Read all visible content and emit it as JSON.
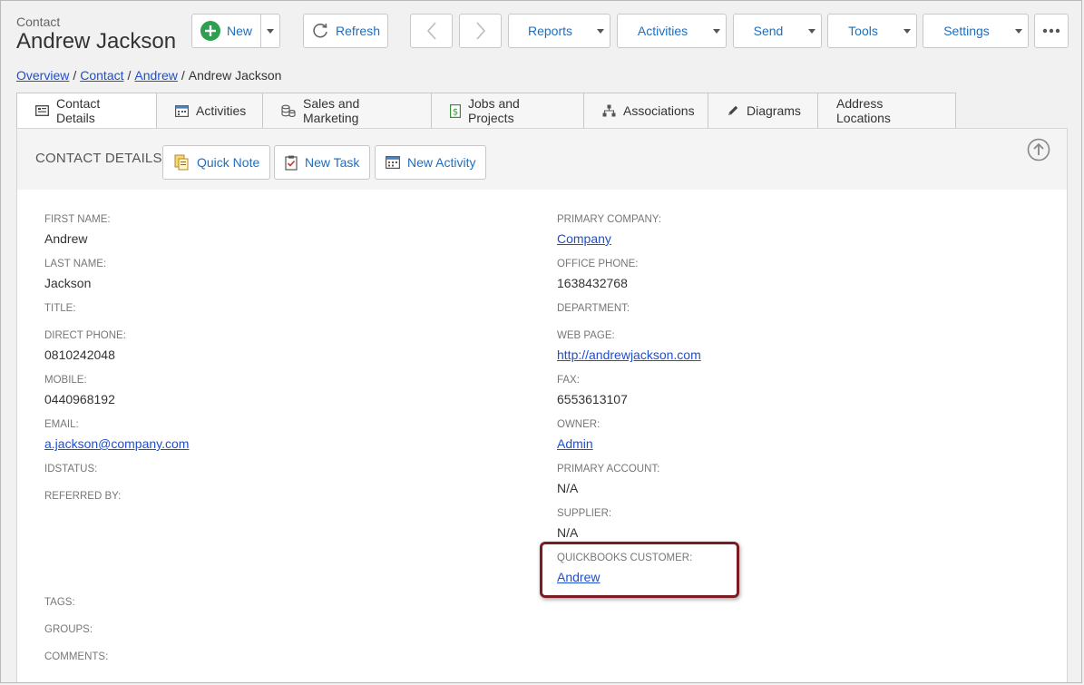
{
  "header": {
    "entity_type": "Contact",
    "entity_name": "Andrew Jackson"
  },
  "toolbar": {
    "new_label": "New",
    "refresh_label": "Refresh",
    "reports_label": "Reports",
    "activities_label": "Activities",
    "send_label": "Send",
    "tools_label": "Tools",
    "settings_label": "Settings"
  },
  "breadcrumb": {
    "items": [
      "Overview",
      "Contact",
      "Andrew"
    ],
    "current": "Andrew Jackson",
    "separator": "/"
  },
  "tabs": [
    {
      "label": "Contact Details",
      "icon": "card-icon"
    },
    {
      "label": "Activities",
      "icon": "calendar-icon"
    },
    {
      "label": "Sales and Marketing",
      "icon": "coins-icon"
    },
    {
      "label": "Jobs and Projects",
      "icon": "dollar-doc-icon"
    },
    {
      "label": "Associations",
      "icon": "org-chart-icon"
    },
    {
      "label": "Diagrams",
      "icon": "pencil-icon"
    },
    {
      "label": "Address Locations",
      "icon": ""
    }
  ],
  "panel": {
    "title": "CONTACT DETAILS",
    "quick_note_label": "Quick Note",
    "new_task_label": "New Task",
    "new_activity_label": "New Activity"
  },
  "fields_left": {
    "first_name": {
      "label": "FIRST NAME:",
      "value": "Andrew"
    },
    "last_name": {
      "label": "LAST NAME:",
      "value": "Jackson"
    },
    "title": {
      "label": "TITLE:",
      "value": ""
    },
    "direct_phone": {
      "label": "DIRECT PHONE:",
      "value": "0810242048"
    },
    "mobile": {
      "label": "MOBILE:",
      "value": "0440968192"
    },
    "email": {
      "label": "EMAIL:",
      "value": "a.jackson@company.com"
    },
    "idstatus": {
      "label": "IDSTATUS:",
      "value": ""
    },
    "referred_by": {
      "label": "REFERRED BY:",
      "value": ""
    },
    "tags": {
      "label": "TAGS:",
      "value": ""
    },
    "groups": {
      "label": "GROUPS:",
      "value": ""
    },
    "comments": {
      "label": "COMMENTS:",
      "value": ""
    }
  },
  "fields_right": {
    "primary_company": {
      "label": "PRIMARY COMPANY:",
      "value": "Company"
    },
    "office_phone": {
      "label": "OFFICE PHONE:",
      "value": "1638432768"
    },
    "department": {
      "label": "DEPARTMENT:",
      "value": ""
    },
    "web_page": {
      "label": "WEB PAGE:",
      "value": "http://andrewjackson.com"
    },
    "fax": {
      "label": "FAX:",
      "value": "6553613107"
    },
    "owner": {
      "label": "OWNER:",
      "value": "Admin"
    },
    "primary_account": {
      "label": "PRIMARY ACCOUNT:",
      "value": "N/A"
    },
    "supplier": {
      "label": "SUPPLIER:",
      "value": "N/A"
    },
    "quickbooks_customer": {
      "label": "QUICKBOOKS CUSTOMER:",
      "value": "Andrew"
    }
  },
  "colors": {
    "link": "#1f4fd1",
    "accent": "#1e6fbf",
    "highlight": "#7a1d22",
    "new_icon": "#2e9e4f"
  }
}
